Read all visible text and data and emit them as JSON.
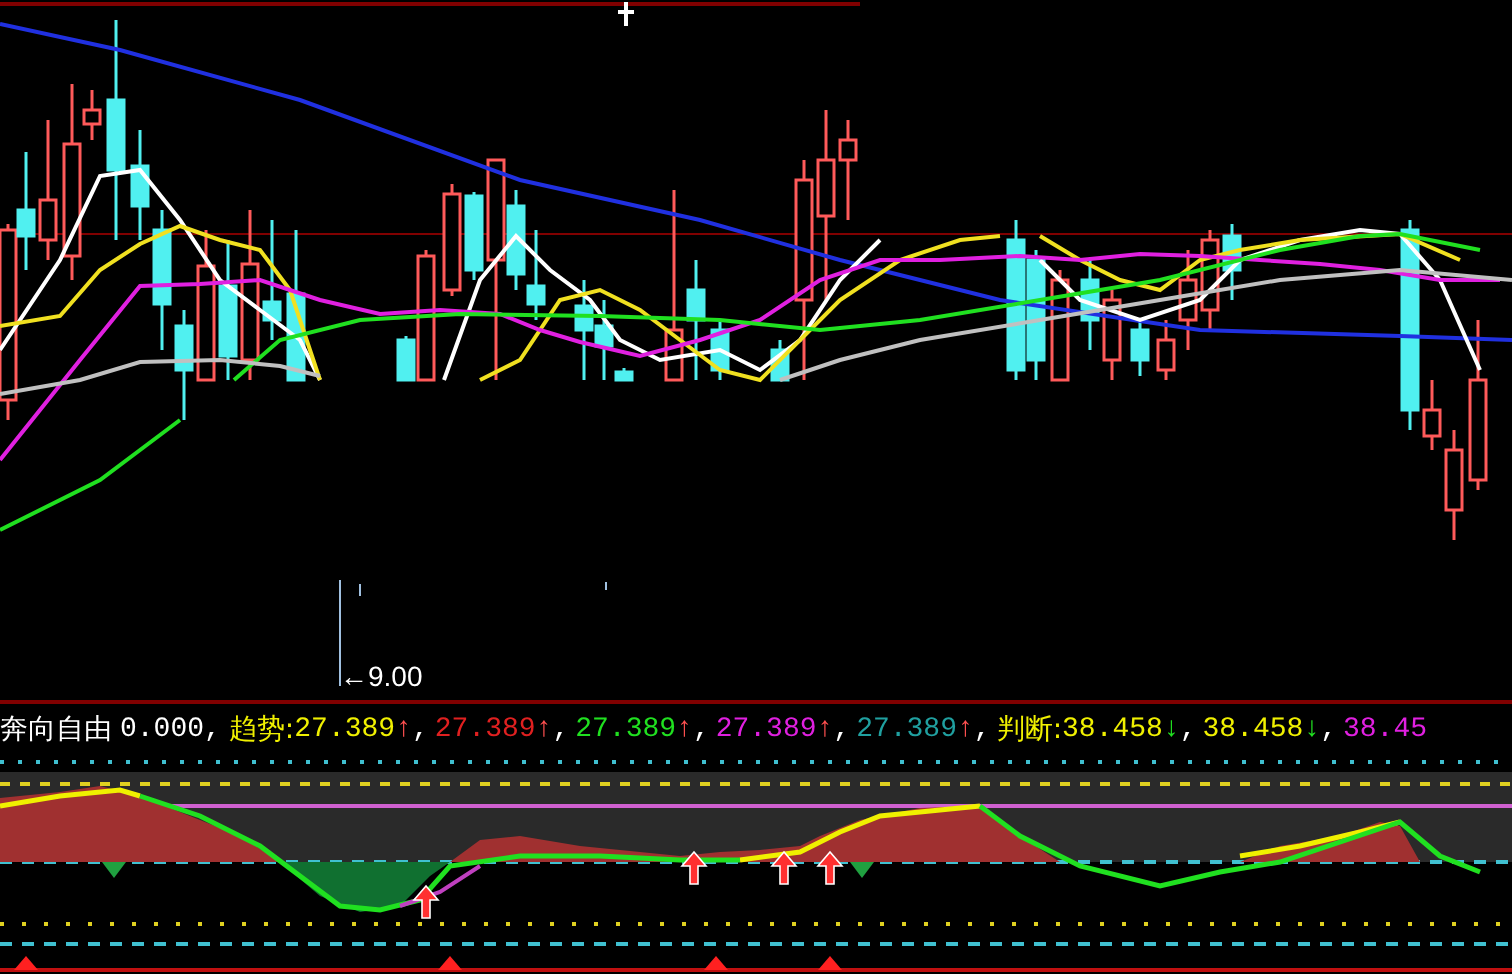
{
  "price_chart": {
    "price_label": "←9.00"
  },
  "indicator": {
    "name": "奔向自由",
    "value": "0.000,",
    "groups": [
      {
        "label": "趋势:",
        "items": [
          {
            "value": "27.389",
            "arrow": {
              "text": "↑",
              "color": "#ff5050"
            },
            "separator": ",",
            "color": "#f0f000"
          },
          {
            "value": "27.389",
            "arrow": {
              "text": "↑",
              "color": "#ff5050"
            },
            "separator": ",",
            "color": "#e02020"
          },
          {
            "value": "27.389",
            "arrow": {
              "text": "↑",
              "color": "#ff5050"
            },
            "separator": ",",
            "color": "#20e020"
          },
          {
            "value": "27.389",
            "arrow": {
              "text": "↑",
              "color": "#ff5050"
            },
            "separator": ",",
            "color": "#e020e0"
          },
          {
            "value": "27.389",
            "arrow": {
              "text": "↑",
              "color": "#ff5050"
            },
            "separator": ",",
            "color": "#20a0a0"
          }
        ]
      },
      {
        "label": "判断:",
        "items": [
          {
            "value": "38.458",
            "arrow": {
              "text": "↓",
              "color": "#20e020"
            },
            "separator": ",",
            "color": "#f0f000"
          },
          {
            "value": "38.458",
            "arrow": {
              "text": "↓",
              "color": "#20e020"
            },
            "separator": ",",
            "color": "#f0f000"
          },
          {
            "value": "38.45",
            "color": "#e020e0"
          }
        ]
      }
    ]
  }
}
